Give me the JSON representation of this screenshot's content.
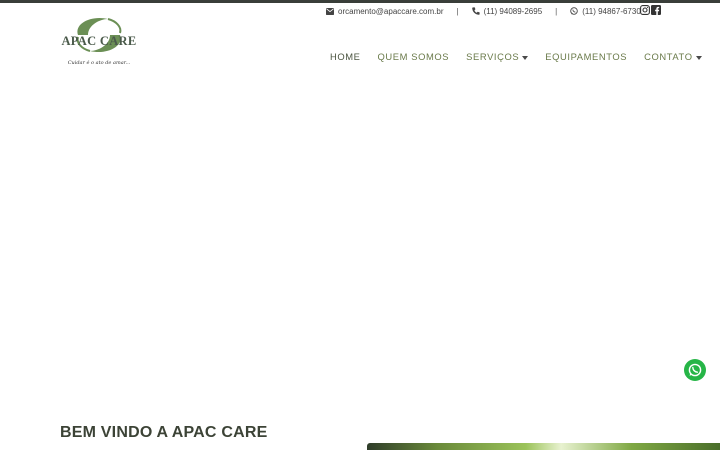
{
  "brand": {
    "name": "APAC CARE",
    "slogan": "Cuidar é o ato de amar...",
    "colors": {
      "primary_green": "#6b8f55",
      "dark_green": "#4b5440",
      "whatsapp": "#26b547"
    }
  },
  "contact": {
    "email": "orcamento@apaccare.com.br",
    "phone": "(11) 94089-2695",
    "whatsapp": "(11) 94867-6730",
    "separator": "|",
    "icons": {
      "email": "envelope-icon",
      "phone": "phone-icon",
      "whatsapp": "whatsapp-icon"
    }
  },
  "social": {
    "icons": [
      "instagram-icon",
      "facebook-icon"
    ]
  },
  "nav": {
    "items": [
      {
        "label": "HOME",
        "active": true,
        "dropdown": false
      },
      {
        "label": "QUEM SOMOS",
        "active": false,
        "dropdown": false
      },
      {
        "label": "SERVIÇOS",
        "active": false,
        "dropdown": true
      },
      {
        "label": "EQUIPAMENTOS",
        "active": false,
        "dropdown": false
      },
      {
        "label": "CONTATO",
        "active": false,
        "dropdown": true
      }
    ]
  },
  "main": {
    "welcome_title": "BEM VINDO A APAC CARE"
  }
}
